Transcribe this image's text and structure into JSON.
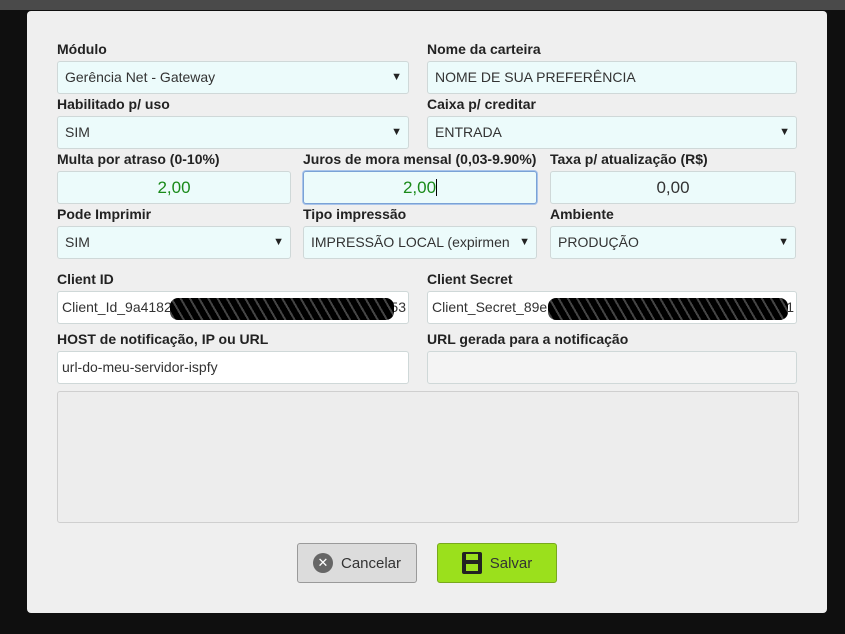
{
  "form": {
    "modulo": {
      "label": "Módulo",
      "value": "Gerência Net - Gateway"
    },
    "nome_carteira": {
      "label": "Nome da carteira",
      "value": "NOME DE SUA PREFERÊNCIA"
    },
    "habilitado": {
      "label": "Habilitado p/ uso",
      "value": "SIM"
    },
    "caixa": {
      "label": "Caixa p/ creditar",
      "value": "ENTRADA"
    },
    "multa": {
      "label": "Multa por atraso (0-10%)",
      "value": "2,00"
    },
    "juros": {
      "label": "Juros de mora mensal (0,03-9.90%)",
      "value": "2,00"
    },
    "taxa": {
      "label": "Taxa p/ atualização (R$)",
      "value": "0,00"
    },
    "pode_imprimir": {
      "label": "Pode Imprimir",
      "value": "SIM"
    },
    "tipo_impressao": {
      "label": "Tipo impressão",
      "value": "IMPRESSÃO LOCAL (expirmen"
    },
    "ambiente": {
      "label": "Ambiente",
      "value": "PRODUÇÃO"
    },
    "client_id": {
      "label": "Client ID",
      "value_start": "Client_Id_9a4182",
      "value_end": "53"
    },
    "client_secret": {
      "label": "Client Secret",
      "value_start": "Client_Secret_89e",
      "value_end": "1"
    },
    "host": {
      "label": "HOST de notificação, IP ou URL",
      "value": "url-do-meu-servidor-ispfy"
    },
    "url_gerada": {
      "label": "URL gerada para a notificação",
      "value": ""
    }
  },
  "buttons": {
    "cancel": "Cancelar",
    "save": "Salvar"
  },
  "icons": {
    "cancel": "close-circle-icon",
    "save": "floppy-disk-icon",
    "dropdown": "caret-down-icon"
  },
  "colors": {
    "save_button": "#9be01c",
    "numeric_text": "#1a8a1a",
    "field_bg": "#ecfbfb"
  }
}
